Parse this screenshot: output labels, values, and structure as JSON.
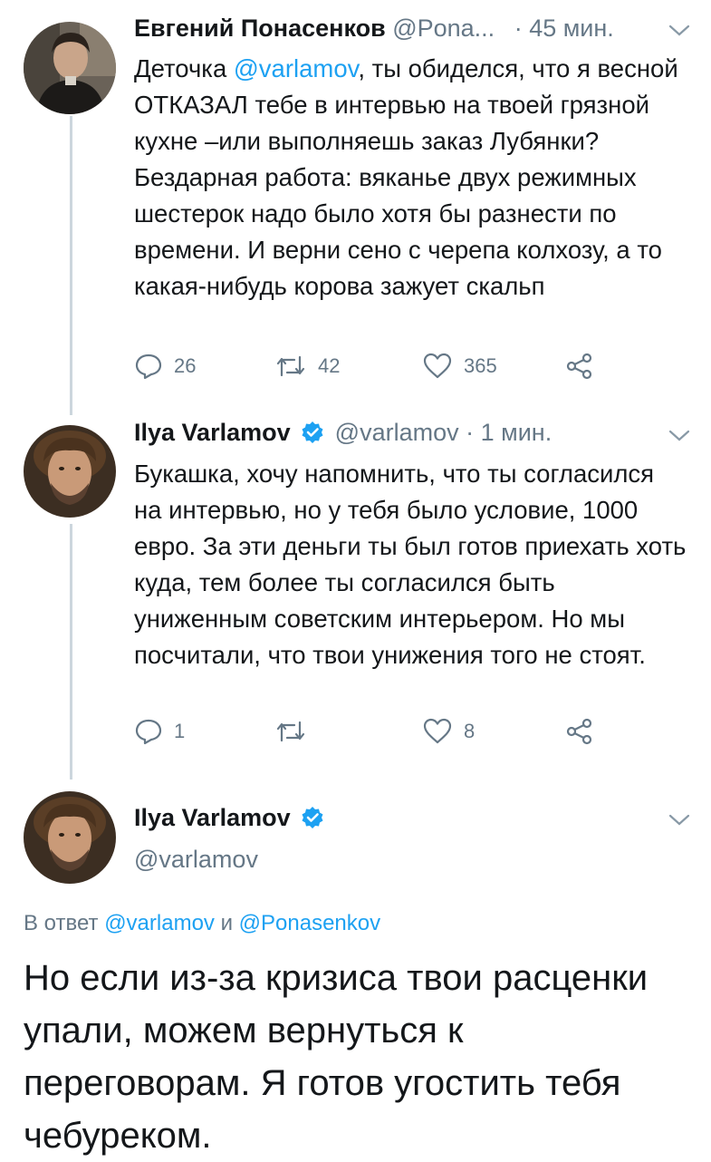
{
  "tweets": [
    {
      "name": "Евгений Понасенков",
      "handle": "@Pona...",
      "time": "· 45 мин.",
      "mention": "@varlamov",
      "text_after_mention": ", ты обиделся, что я весной ОТКАЗАЛ тебе в интервью на твоей грязной кухне –или выполняешь заказ Лубянки? Бездарная работа: вяканье двух режимных шестерок надо было хотя бы разнести по времени. И верни сено с черепа колхозу, а то какая-нибудь корова зажует скальп",
      "text_before_mention": "Деточка ",
      "counts": {
        "replies": "26",
        "retweets": "42",
        "likes": "365"
      }
    },
    {
      "name": "Ilya Varlamov",
      "handle": "@varlamov",
      "time": "· 1 мин.",
      "text": "Букашка, хочу напомнить, что ты согласился на интервью, но у тебя было условие, 1000 евро. За эти деньги ты был готов приехать хоть куда, тем более ты согласился быть униженным советским интерьером. Но мы посчитали, что твои унижения того не стоят.",
      "counts": {
        "replies": "1",
        "retweets": "",
        "likes": "8"
      }
    }
  ],
  "main_tweet": {
    "name": "Ilya Varlamov",
    "handle": "@varlamov",
    "reply_prefix": "В ответ ",
    "reply_user1": "@varlamov",
    "reply_and": " и ",
    "reply_user2": "@Ponasenkov",
    "text": "Но если из-за кризиса твои расценки упали, можем вернуться к переговорам. Я готов угостить тебя чебуреком."
  },
  "colors": {
    "accent": "#1da1f2",
    "muted": "#657786",
    "text": "#14171a",
    "thread_line": "#ccd6dd"
  },
  "icons": [
    "reply-icon",
    "retweet-icon",
    "like-icon",
    "share-icon",
    "verified-icon",
    "chevron-down-icon"
  ]
}
